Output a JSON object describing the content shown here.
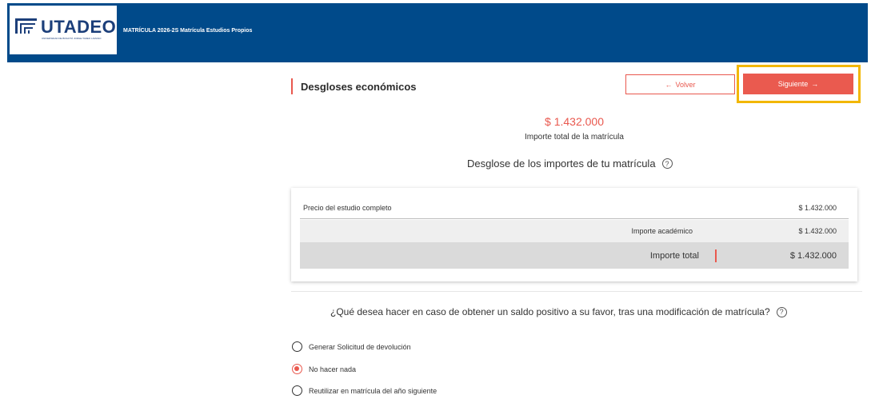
{
  "header": {
    "logo_text": "UTADEO",
    "logo_subtitle": "UNIVERSIDAD DE BOGOTÁ JORGE TADEO LOZANO",
    "title": "MATRÍCULA 2026-2S Matrícula Estudios Propios"
  },
  "section": {
    "title": "Desgloses económicos"
  },
  "actions": {
    "back_label": "Volver",
    "next_label": "Siguiente"
  },
  "summary": {
    "total_amount": "$ 1.432.000",
    "total_caption": "Importe total de la matrícula"
  },
  "breakdown": {
    "heading": "Desglose de los importes de tu matrícula",
    "rows": [
      {
        "label": "Precio del estudio completo",
        "value": "$ 1.432.000"
      },
      {
        "label": "Importe académico",
        "value": "$ 1.432.000"
      },
      {
        "label": "Importe total",
        "value": "$ 1.432.000"
      }
    ]
  },
  "question": {
    "text": "¿Qué desea hacer en caso de obtener un saldo positivo a su favor, tras una modificación de matrícula?",
    "options": [
      {
        "label": "Generar Solicitud de devolución",
        "selected": false
      },
      {
        "label": "No hacer nada",
        "selected": true
      },
      {
        "label": "Reutilizar en matrícula del año siguiente",
        "selected": false
      }
    ]
  },
  "colors": {
    "brand_blue": "#004a8a",
    "accent": "#e9584e",
    "highlight": "#f2b705"
  }
}
